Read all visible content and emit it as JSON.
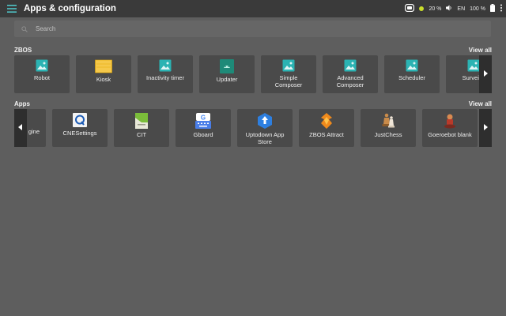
{
  "header": {
    "title": "Apps & configuration",
    "status": {
      "battery_level_text": "20 %",
      "language": "EN",
      "battery_percent": "100 %"
    }
  },
  "search": {
    "placeholder": "Search"
  },
  "zbos": {
    "label": "ZBOS",
    "view_all": "View all",
    "items": [
      {
        "label": "Robot",
        "icon": "image-icon"
      },
      {
        "label": "Kiosk",
        "icon": "folder-icon"
      },
      {
        "label": "Inactivity timer",
        "icon": "image-icon"
      },
      {
        "label": "Updater",
        "icon": "android-icon"
      },
      {
        "label": "Simple Composer",
        "icon": "image-icon"
      },
      {
        "label": "Advanced Composer",
        "icon": "image-icon"
      },
      {
        "label": "Scheduler",
        "icon": "image-icon"
      },
      {
        "label": "Surveilla",
        "icon": "image-icon"
      }
    ]
  },
  "apps": {
    "label": "Apps",
    "view_all": "View all",
    "items": [
      {
        "label": "gine",
        "icon": "none"
      },
      {
        "label": "CNESettings",
        "icon": "q-app-icon"
      },
      {
        "label": "CIT",
        "icon": "cit-icon"
      },
      {
        "label": "Gboard",
        "icon": "gboard-icon"
      },
      {
        "label": "Uptodown App Store",
        "icon": "uptodown-icon"
      },
      {
        "label": "ZBOS Attract",
        "icon": "flame-icon"
      },
      {
        "label": "JustChess",
        "icon": "chess-icon"
      },
      {
        "label": "Goeroebot blank",
        "icon": "robot-icon"
      }
    ]
  },
  "colors": {
    "topbar": "#3a3a3a",
    "background": "#5e5e5e",
    "tile": "#4a4a4a",
    "accent_teal": "#2bb3b3"
  }
}
